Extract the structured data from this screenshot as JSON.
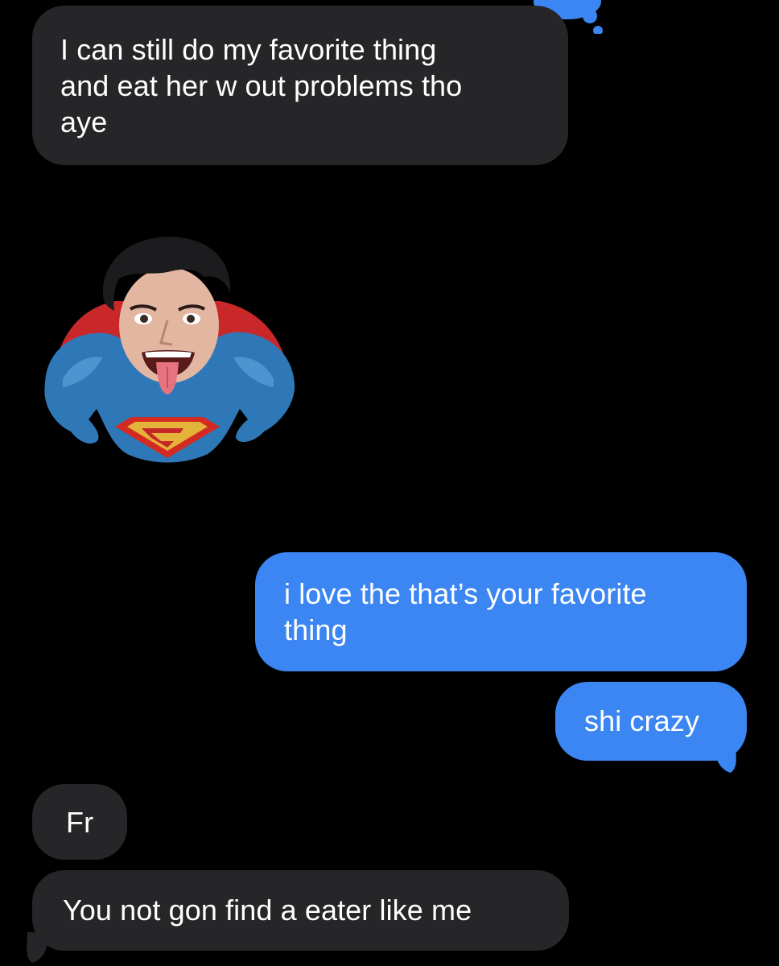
{
  "conversation": {
    "messages": [
      {
        "direction": "incoming",
        "text": "I can still do my favorite thing\nand eat her w out problems tho\naye"
      },
      {
        "direction": "incoming",
        "kind": "sticker",
        "icon": "superhero-sticker"
      },
      {
        "direction": "outgoing",
        "text": "i love the that’s your favorite\nthing"
      },
      {
        "direction": "outgoing",
        "text": "shi crazy"
      },
      {
        "direction": "incoming",
        "text": "Fr"
      },
      {
        "direction": "incoming",
        "text": "You not gon find a eater like me"
      }
    ],
    "tapback_icon": "tapback-reaction-icon"
  },
  "colors": {
    "background": "#000000",
    "incoming_bubble": "#262629",
    "outgoing_bubble": "#3b86f3",
    "text": "#ffffff"
  }
}
